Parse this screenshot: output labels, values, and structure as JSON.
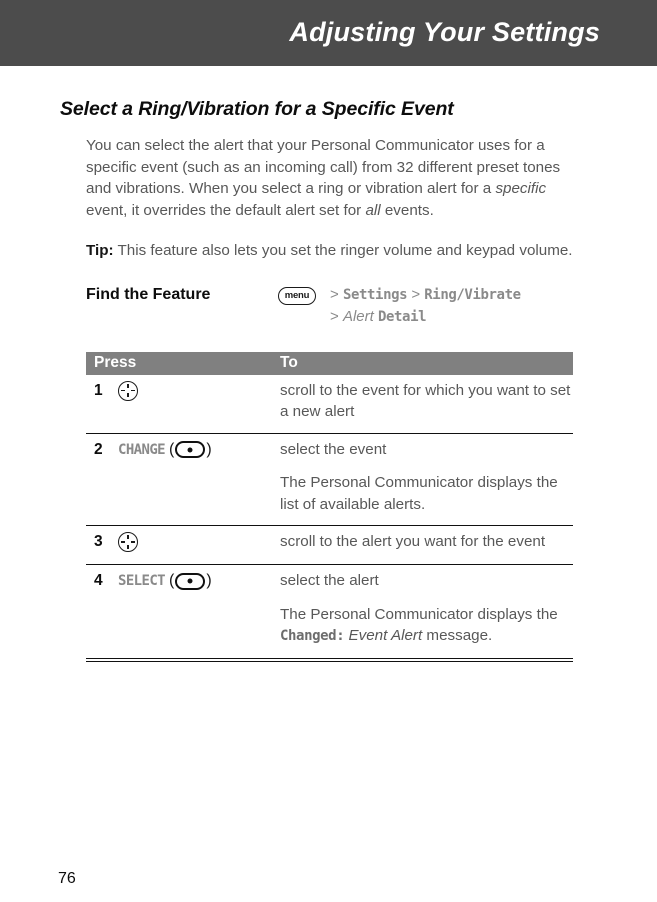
{
  "header": {
    "title": "Adjusting Your Settings"
  },
  "section": {
    "heading": "Select a Ring/Vibration for a Specific Event",
    "paragraph_1a": "You can select the alert that your Personal Communicator uses for a specific event (such as an incoming call) from 32 different preset tones and vibrations. When you select a ring or vibration alert for a ",
    "paragraph_1_em1": "specific",
    "paragraph_1b": " event, it overrides the default alert set for ",
    "paragraph_1_em2": "all",
    "paragraph_1c": " events.",
    "tip_label": "Tip:",
    "tip_text": " This feature also lets you set the ringer volume and keypad volume."
  },
  "find_feature": {
    "label": "Find the Feature",
    "menu_key": "menu",
    "separator": ">",
    "path_line1_term1": "Settings",
    "path_line1_term2": "Ring/Vibrate",
    "path_line2_term1": "Alert",
    "path_line2_term2": "Detail"
  },
  "steps_table": {
    "columns": [
      "Press",
      "To"
    ],
    "rows": [
      {
        "num": "1",
        "key_type": "nav-key",
        "key_label": "",
        "to": [
          "scroll to the event for which you want to set a new alert"
        ]
      },
      {
        "num": "2",
        "key_type": "soft-key",
        "key_label": "CHANGE",
        "to": [
          "select the event",
          "The Personal Communicator displays the list of available alerts."
        ]
      },
      {
        "num": "3",
        "key_type": "nav-key",
        "key_label": "",
        "to": [
          "scroll to the alert you want for the event"
        ]
      },
      {
        "num": "4",
        "key_type": "soft-key",
        "key_label": "SELECT",
        "to_prefix": "select the alert",
        "to_line2_a": "The Personal Communicator displays the ",
        "to_line2_code": "Changed:",
        "to_line2_b": " ",
        "to_line2_em": "Event Alert",
        "to_line2_c": " message."
      }
    ],
    "paren_open": "(",
    "paren_close": ")"
  },
  "footer": {
    "page_number": "76"
  }
}
